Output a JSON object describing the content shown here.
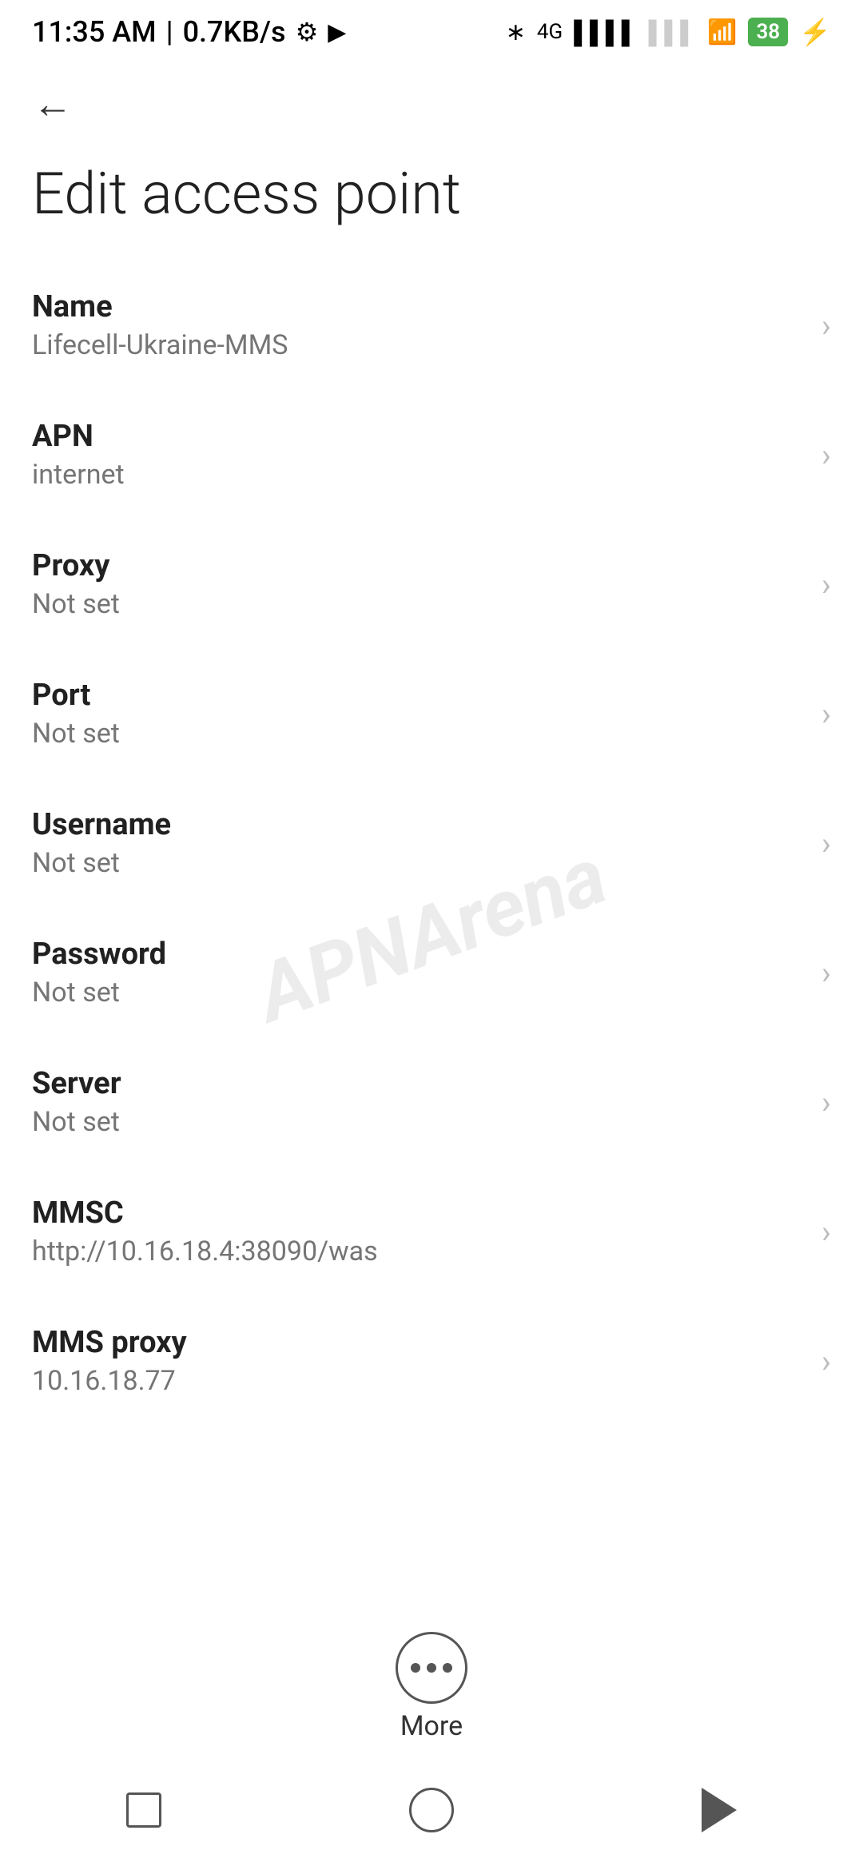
{
  "status_bar": {
    "time": "11:35 AM",
    "network_speed": "0.7KB/s"
  },
  "toolbar": {
    "back_label": "←"
  },
  "page": {
    "title": "Edit access point"
  },
  "settings_items": [
    {
      "label": "Name",
      "value": "Lifecell-Ukraine-MMS"
    },
    {
      "label": "APN",
      "value": "internet"
    },
    {
      "label": "Proxy",
      "value": "Not set"
    },
    {
      "label": "Port",
      "value": "Not set"
    },
    {
      "label": "Username",
      "value": "Not set"
    },
    {
      "label": "Password",
      "value": "Not set"
    },
    {
      "label": "Server",
      "value": "Not set"
    },
    {
      "label": "MMSC",
      "value": "http://10.16.18.4:38090/was"
    },
    {
      "label": "MMS proxy",
      "value": "10.16.18.77"
    }
  ],
  "more_button": {
    "label": "More"
  },
  "watermark": {
    "text": "APNArena"
  }
}
